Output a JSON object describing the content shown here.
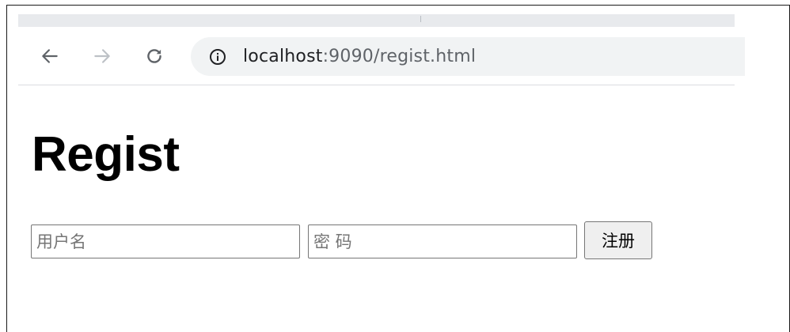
{
  "browser": {
    "address_bar": {
      "url_host": "localhost",
      "url_rest": ":9090/regist.html"
    },
    "icons": {
      "back": "arrow-left-icon",
      "forward": "arrow-right-icon",
      "reload": "reload-icon",
      "site_info": "info-circle-icon"
    },
    "colors": {
      "toolbar_icon": "#5f6368",
      "toolbar_icon_disabled": "#bdc1c6",
      "omnibox_bg": "#f1f3f4",
      "tabstrip_bg": "#e8eaed"
    }
  },
  "page": {
    "title": "Regist",
    "form": {
      "username": {
        "placeholder": "用户名",
        "value": ""
      },
      "password": {
        "placeholder": "密 码",
        "value": ""
      },
      "submit_label": "注册"
    }
  }
}
